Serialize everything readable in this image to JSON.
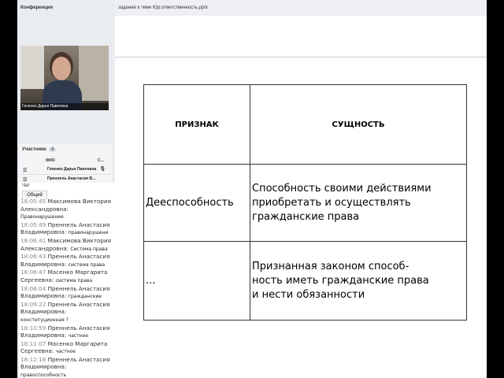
{
  "conference": {
    "title": "Конференция",
    "presenter_name": "Гененко Дарья Павловна"
  },
  "participants": {
    "title": "Участники",
    "count": "4",
    "col_name": "ФИО",
    "col_status": "С...",
    "rows": [
      {
        "name": "Гененко Дарья Павловна"
      },
      {
        "name": "Преннель Анастасия В..."
      }
    ]
  },
  "chat": {
    "title": "Чат",
    "tab": "Общий",
    "messages": [
      {
        "time": "18:05:45",
        "author": "Максимова Виктория",
        "text": ""
      },
      {
        "time": "",
        "author": "Александровна:",
        "text": ""
      },
      {
        "time": "",
        "author": "",
        "text": "Правонарушение"
      },
      {
        "time": "18:05:49",
        "author": "Преннель Анастасия",
        "text": ""
      },
      {
        "time": "",
        "author": "Владимировна:",
        "text": "правонарушени"
      },
      {
        "time": "18:06:41",
        "author": "Максимова Виктория",
        "text": ""
      },
      {
        "time": "",
        "author": "Александровна:",
        "text": "Система права"
      },
      {
        "time": "18:06:43",
        "author": "Преннель Анастасия",
        "text": ""
      },
      {
        "time": "",
        "author": "Владимировна:",
        "text": "система права"
      },
      {
        "time": "18:06:47",
        "author": "Масенко Маргарита",
        "text": ""
      },
      {
        "time": "",
        "author": "Сергеевна:",
        "text": "система права"
      },
      {
        "time": "18:08:04",
        "author": "Преннель Анастасия",
        "text": ""
      },
      {
        "time": "",
        "author": "Владимировна:",
        "text": "гражданские"
      },
      {
        "time": "18:09:22",
        "author": "Преннель Анастасия",
        "text": ""
      },
      {
        "time": "",
        "author": "Владимировна:",
        "text": ""
      },
      {
        "time": "",
        "author": "",
        "text": "конституционная ?"
      },
      {
        "time": "18:10:59",
        "author": "Преннель Анастасия",
        "text": ""
      },
      {
        "time": "",
        "author": "Владимировна:",
        "text": "частное"
      },
      {
        "time": "18:11:07",
        "author": "Масенко Маргарита",
        "text": ""
      },
      {
        "time": "",
        "author": "Сергеевна:",
        "text": "частное"
      },
      {
        "time": "18:12:16",
        "author": "Преннель Анастасия",
        "text": ""
      },
      {
        "time": "",
        "author": "Владимировна:",
        "text": ""
      },
      {
        "time": "",
        "author": "",
        "text": "правоспособность"
      }
    ]
  },
  "presentation": {
    "file_name": "задание к теме Юр.ответственность.pptx",
    "table": {
      "header": [
        "ПРИЗНАК",
        "СУЩНОСТЬ"
      ],
      "rows": [
        {
          "feature": "Дееспособность",
          "essence": [
            "Способность своими действиями",
            "приобретать и осуществлять",
            "гражданские права"
          ]
        },
        {
          "feature": "...",
          "essence": [
            "Признанная законом способ-",
            "ность иметь гражданские права",
            "и нести обязанности"
          ]
        }
      ]
    }
  }
}
